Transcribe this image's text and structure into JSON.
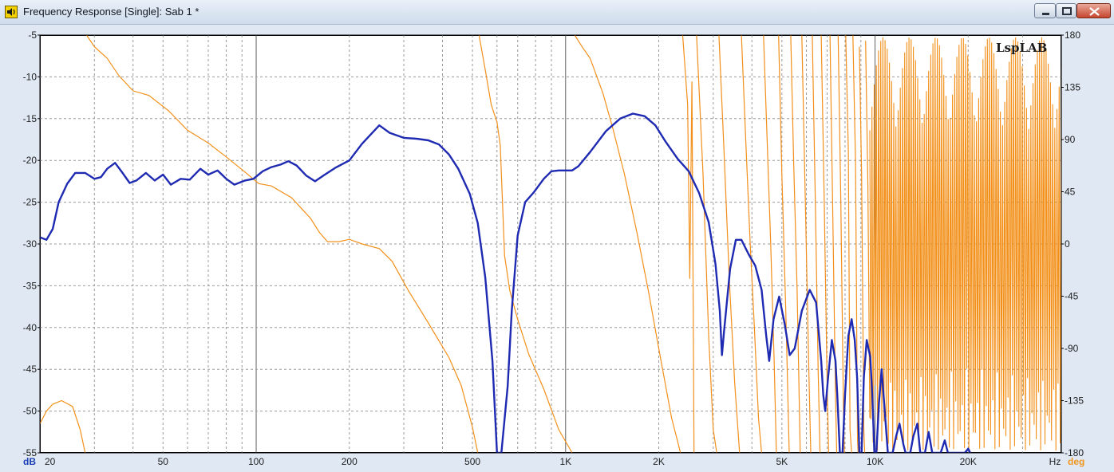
{
  "window": {
    "title": "Frequency Response [Single]: Sab 1 *",
    "icon": "speaker-icon"
  },
  "window_buttons": {
    "minimize": "minimize-icon",
    "maximize": "maximize-icon",
    "close": "close-icon"
  },
  "watermark": "LspLAB",
  "colors": {
    "magnitude": "#1f2ab2",
    "phase": "#f2901a",
    "grid": "#9a9a9a",
    "major_grid": "#606060"
  },
  "chart_data": {
    "type": "line",
    "x_scale": "log",
    "xlim": [
      20,
      40000
    ],
    "ylim_left": [
      -55,
      -5
    ],
    "ylim_right": [
      -180,
      180
    ],
    "x_unit": "Hz",
    "y_left_unit": "dB",
    "y_right_unit": "deg",
    "x_ticks": [
      {
        "value": 20,
        "label": "20"
      },
      {
        "value": 50,
        "label": "50"
      },
      {
        "value": 100,
        "label": "100"
      },
      {
        "value": 200,
        "label": "200"
      },
      {
        "value": 500,
        "label": "500"
      },
      {
        "value": 1000,
        "label": "1K"
      },
      {
        "value": 2000,
        "label": "2K"
      },
      {
        "value": 5000,
        "label": "5K"
      },
      {
        "value": 10000,
        "label": "10K"
      },
      {
        "value": 20000,
        "label": "20K"
      }
    ],
    "y_left_ticks": [
      -5,
      -10,
      -15,
      -20,
      -25,
      -30,
      -35,
      -40,
      -45,
      -50,
      -55
    ],
    "y_right_ticks": [
      180,
      135,
      90,
      45,
      0,
      -45,
      -90,
      -135,
      -180
    ],
    "grid": true,
    "series": [
      {
        "color": "#1f2ab2",
        "axis": "left",
        "points": [
          [
            20,
            -29.2
          ],
          [
            21,
            -29.5
          ],
          [
            22,
            -28.2
          ],
          [
            23,
            -25
          ],
          [
            24.5,
            -22.8
          ],
          [
            26,
            -21.5
          ],
          [
            28,
            -21.5
          ],
          [
            30,
            -22.2
          ],
          [
            31.5,
            -22
          ],
          [
            33,
            -21
          ],
          [
            35,
            -20.3
          ],
          [
            37,
            -21.5
          ],
          [
            39,
            -22.7
          ],
          [
            41,
            -22.4
          ],
          [
            44,
            -21.5
          ],
          [
            47,
            -22.4
          ],
          [
            50,
            -21.7
          ],
          [
            53,
            -22.9
          ],
          [
            57,
            -22.2
          ],
          [
            61,
            -22.3
          ],
          [
            66,
            -21
          ],
          [
            70,
            -21.7
          ],
          [
            75,
            -21.2
          ],
          [
            80,
            -22.2
          ],
          [
            85,
            -22.9
          ],
          [
            92,
            -22.4
          ],
          [
            98,
            -22.2
          ],
          [
            105,
            -21.3
          ],
          [
            112,
            -20.8
          ],
          [
            120,
            -20.5
          ],
          [
            127,
            -20.1
          ],
          [
            135,
            -20.6
          ],
          [
            145,
            -21.8
          ],
          [
            155,
            -22.5
          ],
          [
            165,
            -21.8
          ],
          [
            180,
            -20.9
          ],
          [
            200,
            -20
          ],
          [
            220,
            -18
          ],
          [
            250,
            -15.8
          ],
          [
            270,
            -16.7
          ],
          [
            300,
            -17.3
          ],
          [
            330,
            -17.4
          ],
          [
            360,
            -17.6
          ],
          [
            390,
            -18.1
          ],
          [
            420,
            -19.3
          ],
          [
            450,
            -21
          ],
          [
            490,
            -24
          ],
          [
            520,
            -27.5
          ],
          [
            550,
            -34
          ],
          [
            580,
            -44
          ],
          [
            600,
            -55
          ],
          [
            620,
            -55
          ],
          [
            650,
            -47
          ],
          [
            670,
            -38
          ],
          [
            700,
            -29
          ],
          [
            740,
            -25
          ],
          [
            790,
            -23.8
          ],
          [
            850,
            -22.2
          ],
          [
            900,
            -21.3
          ],
          [
            950,
            -21.2
          ],
          [
            1000,
            -21.2
          ],
          [
            1050,
            -21.2
          ],
          [
            1100,
            -20.7
          ],
          [
            1200,
            -19
          ],
          [
            1350,
            -16.5
          ],
          [
            1500,
            -15
          ],
          [
            1650,
            -14.4
          ],
          [
            1800,
            -14.7
          ],
          [
            1950,
            -15.8
          ],
          [
            2100,
            -17.7
          ],
          [
            2300,
            -19.8
          ],
          [
            2500,
            -21.3
          ],
          [
            2700,
            -23.9
          ],
          [
            2900,
            -27.4
          ],
          [
            3050,
            -32.4
          ],
          [
            3150,
            -38
          ],
          [
            3200,
            -43.3
          ],
          [
            3250,
            -40.5
          ],
          [
            3400,
            -33
          ],
          [
            3550,
            -29.5
          ],
          [
            3700,
            -29.5
          ],
          [
            3900,
            -31.2
          ],
          [
            4100,
            -32.6
          ],
          [
            4300,
            -35.5
          ],
          [
            4450,
            -41
          ],
          [
            4550,
            -44
          ],
          [
            4700,
            -39
          ],
          [
            4900,
            -36.3
          ],
          [
            5100,
            -39.5
          ],
          [
            5300,
            -43.3
          ],
          [
            5500,
            -42.5
          ],
          [
            5800,
            -38
          ],
          [
            6150,
            -35.5
          ],
          [
            6450,
            -37
          ],
          [
            6700,
            -44
          ],
          [
            6800,
            -48
          ],
          [
            6900,
            -50
          ],
          [
            7050,
            -46
          ],
          [
            7250,
            -41.5
          ],
          [
            7450,
            -44
          ],
          [
            7550,
            -48
          ],
          [
            7700,
            -55
          ],
          [
            7850,
            -55
          ],
          [
            8000,
            -48
          ],
          [
            8200,
            -41
          ],
          [
            8400,
            -39
          ],
          [
            8600,
            -41.5
          ],
          [
            8750,
            -46
          ],
          [
            8900,
            -55
          ],
          [
            9050,
            -55
          ],
          [
            9200,
            -46
          ],
          [
            9400,
            -41.5
          ],
          [
            9650,
            -43.5
          ],
          [
            9800,
            -48
          ],
          [
            9950,
            -55
          ],
          [
            10100,
            -55
          ],
          [
            10300,
            -49
          ],
          [
            10500,
            -45
          ],
          [
            10800,
            -51
          ],
          [
            11000,
            -55
          ],
          [
            11400,
            -55
          ],
          [
            11700,
            -53
          ],
          [
            12000,
            -51.5
          ],
          [
            12350,
            -54
          ],
          [
            12550,
            -55
          ],
          [
            13000,
            -55
          ],
          [
            13300,
            -53
          ],
          [
            13700,
            -51.5
          ],
          [
            14000,
            -55
          ],
          [
            14500,
            -55
          ],
          [
            14900,
            -52.5
          ],
          [
            15300,
            -55
          ],
          [
            16300,
            -55
          ],
          [
            16800,
            -53.5
          ],
          [
            17200,
            -55
          ],
          [
            19500,
            -55
          ],
          [
            20000,
            -54.5
          ],
          [
            20300,
            -55
          ]
        ]
      },
      {
        "color": "#f2901a",
        "axis": "right",
        "segments": [
          [
            [
              20,
              -155
            ],
            [
              21,
              -144
            ],
            [
              22,
              -138
            ],
            [
              23.5,
              -135
            ],
            [
              25.5,
              -140
            ],
            [
              27,
              -160
            ],
            [
              28,
              -180
            ]
          ],
          [
            [
              28.3,
              180
            ],
            [
              30,
              170
            ],
            [
              33,
              160
            ],
            [
              36,
              145
            ],
            [
              40,
              132
            ],
            [
              45,
              128
            ],
            [
              52,
              115
            ],
            [
              60,
              98
            ],
            [
              70,
              87
            ],
            [
              80,
              75
            ],
            [
              92,
              62
            ],
            [
              102,
              52
            ],
            [
              112,
              50
            ],
            [
              130,
              40
            ],
            [
              150,
              22
            ],
            [
              160,
              10
            ],
            [
              170,
              2
            ],
            [
              185,
              2
            ],
            [
              200,
              4
            ],
            [
              220,
              0
            ],
            [
              250,
              -4
            ],
            [
              275,
              -15
            ],
            [
              310,
              -40
            ],
            [
              360,
              -68
            ],
            [
              420,
              -98
            ],
            [
              460,
              -122
            ],
            [
              500,
              -158
            ],
            [
              520,
              -180
            ]
          ],
          [
            [
              525,
              180
            ],
            [
              550,
              150
            ],
            [
              575,
              120
            ],
            [
              600,
              105
            ],
            [
              615,
              85
            ],
            [
              635,
              -10
            ],
            [
              660,
              -40
            ],
            [
              700,
              -65
            ],
            [
              760,
              -95
            ],
            [
              850,
              -125
            ],
            [
              950,
              -160
            ],
            [
              1050,
              -180
            ]
          ],
          [
            [
              1070,
              180
            ],
            [
              1130,
              170
            ],
            [
              1200,
              160
            ],
            [
              1320,
              130
            ],
            [
              1420,
              100
            ],
            [
              1550,
              60
            ],
            [
              1700,
              10
            ],
            [
              1850,
              -40
            ],
            [
              2000,
              -90
            ],
            [
              2200,
              -150
            ],
            [
              2300,
              -170
            ],
            [
              2350,
              -180
            ]
          ],
          [
            [
              2390,
              180
            ],
            [
              2480,
              120
            ],
            [
              2520,
              -30
            ],
            [
              2560,
              140
            ],
            [
              2600,
              -180
            ]
          ],
          [
            [
              2650,
              180
            ],
            [
              2780,
              60
            ],
            [
              2900,
              -80
            ],
            [
              3000,
              -160
            ],
            [
              3080,
              -180
            ]
          ],
          [
            [
              3130,
              180
            ],
            [
              3250,
              80
            ],
            [
              3380,
              -30
            ],
            [
              3520,
              -120
            ],
            [
              3650,
              -180
            ]
          ],
          [
            [
              3700,
              180
            ],
            [
              3820,
              90
            ],
            [
              3950,
              0
            ],
            [
              4070,
              -70
            ],
            [
              4200,
              -150
            ],
            [
              4300,
              -180
            ]
          ],
          [
            [
              4360,
              180
            ],
            [
              4480,
              90
            ],
            [
              4600,
              0
            ],
            [
              4720,
              -100
            ],
            [
              4800,
              -180
            ]
          ],
          [
            [
              4880,
              180
            ],
            [
              5000,
              60
            ],
            [
              5150,
              -60
            ],
            [
              5280,
              -180
            ]
          ],
          [
            [
              5340,
              180
            ],
            [
              5460,
              70
            ],
            [
              5600,
              -40
            ],
            [
              5730,
              -180
            ]
          ],
          [
            [
              5800,
              180
            ],
            [
              5950,
              40
            ],
            [
              6100,
              -100
            ],
            [
              6200,
              -180
            ]
          ],
          [
            [
              6270,
              180
            ],
            [
              6420,
              30
            ],
            [
              6550,
              -110
            ],
            [
              6640,
              -180
            ]
          ],
          [
            [
              6700,
              180
            ],
            [
              6850,
              40
            ],
            [
              7000,
              -120
            ],
            [
              7080,
              -180
            ]
          ],
          [
            [
              7150,
              180
            ],
            [
              7300,
              30
            ],
            [
              7450,
              -130
            ],
            [
              7520,
              -180
            ]
          ],
          [
            [
              7600,
              180
            ],
            [
              7750,
              40
            ],
            [
              7900,
              -140
            ],
            [
              7960,
              -180
            ]
          ],
          [
            [
              8040,
              180
            ],
            [
              8200,
              80
            ],
            [
              8300,
              -160
            ],
            [
              8400,
              -180
            ]
          ],
          [
            [
              8480,
              180
            ],
            [
              8650,
              70
            ],
            [
              8780,
              -170
            ],
            [
              8820,
              -180
            ]
          ],
          [
            [
              8900,
              170
            ],
            [
              9050,
              60
            ],
            [
              9200,
              -160
            ],
            [
              9260,
              -180
            ]
          ],
          [
            [
              9320,
              175
            ],
            [
              9480,
              50
            ],
            [
              9620,
              -150
            ]
          ]
        ],
        "dense_band": {
          "from": 9620,
          "to": 40000,
          "cycles": 88,
          "amplitude_high": 178,
          "amplitude_low": -178
        }
      }
    ]
  }
}
